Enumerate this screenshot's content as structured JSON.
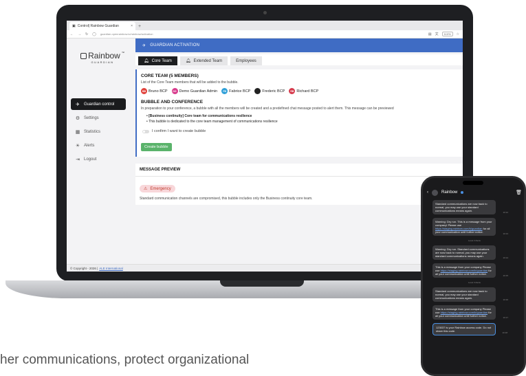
{
  "browser": {
    "tab_title": "Control| Rainbow Guardian",
    "tab_close": "×",
    "new_tab": "+",
    "url": "guardian.openrainbow.io/rainbow/activation",
    "zoom": "110%"
  },
  "sidebar": {
    "logo_text": "Rainbow",
    "logo_tm": "™",
    "logo_sub": "GUARDIAN",
    "items": [
      {
        "label": "Guardian control",
        "icon": "rocket-icon",
        "glyph": "🚀"
      },
      {
        "label": "Settings",
        "icon": "gear-icon",
        "glyph": "⚙"
      },
      {
        "label": "Statistics",
        "icon": "chart-icon",
        "glyph": "▦"
      },
      {
        "label": "Alerts",
        "icon": "alert-icon",
        "glyph": "☀"
      },
      {
        "label": "Logout",
        "icon": "logout-icon",
        "glyph": "⇥"
      }
    ]
  },
  "main": {
    "banner_title": "GUARDIAN ACTIVATION",
    "tabs": [
      {
        "label": "Core Team"
      },
      {
        "label": "Extended Team"
      },
      {
        "label": "Employees"
      }
    ],
    "core_title": "CORE TEAM (5 MEMBERS)",
    "core_desc": "List of the Core Team members that will be added to the bubble.",
    "members": [
      {
        "initials": "BB",
        "name": "Bruno BCP",
        "color": "#e0413b"
      },
      {
        "initials": "DG",
        "name": "Demo Guardian Admin",
        "color": "#d83a8c"
      },
      {
        "initials": "FB",
        "name": "Fabrice BCP",
        "color": "#2e9fd8"
      },
      {
        "initials": "",
        "name": "Frederic BCP",
        "color": "#222222"
      },
      {
        "initials": "RB",
        "name": "Richard BCP",
        "color": "#d63a4c"
      }
    ],
    "bubble_title": "BUBBLE AND CONFERENCE",
    "bubble_desc": "In preparation to your conference, a bubble with all the members will be created and a predefined chat message posted to alert them. This message can be previewed",
    "bubble_name": "[Business continuity] Core team for communications resilience",
    "bubble_detail": "This bubble is dedicated to the core team management of communications resilience",
    "confirm_label": "I confirm I want to create bubble",
    "create_button": "Create bubble",
    "preview_title": "MESSAGE PREVIEW",
    "emergency_label": "Emergency",
    "preview_text": "Standard communication channels are compromised, this bubble includes only the Business continuity core team."
  },
  "footer": {
    "copyright": "© Copyright - 2026 |",
    "link": "ALE International"
  },
  "phone": {
    "back": "‹",
    "title": "Rainbow",
    "trash": "🗑",
    "messages": [
      {
        "text": "Standard communications are now back to normal, you may use your standard communications means again.",
        "time": "10:12"
      },
      {
        "text": "Warning: Dry run. This is a message from your company! Please use",
        "link": "https://staging.rainbow.com/b/guardian",
        "rest": "for all your communication until further notice.",
        "time": "10:13"
      },
      {
        "sep": "Level 2 Alerte"
      },
      {
        "text": "Warning: Dry run. Standard communications are now back to normal, you may use your standard communications means again.",
        "time": "10:14"
      },
      {
        "text": "This is a message from your company Please use",
        "link": "https://staging.rainbow.com/b/guardian",
        "rest": "for all your communication until further notice.",
        "time": "10:15"
      },
      {
        "sep": "Level 3 Alerte"
      },
      {
        "text": "Standard communications are now back to normal, you may use your standard communications means again.",
        "time": "10:16"
      },
      {
        "text": "This is a message from your company Please use",
        "link": "https://staging.rainbow.com/b/guardian",
        "rest": "for all your communication until further notice.",
        "time": "10:17"
      },
      {
        "text": "123037 is your Rainbow access code. Do not share this code.",
        "time": "10:18"
      }
    ]
  },
  "tagline": "her communications, protect organizational"
}
